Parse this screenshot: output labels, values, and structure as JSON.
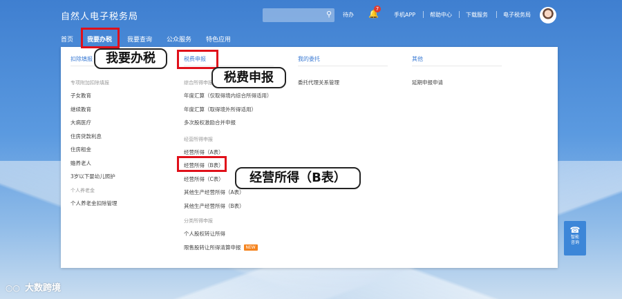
{
  "header": {
    "title": "自然人电子税务局",
    "search_placeholder": "",
    "todo_label": "待办",
    "notification_count": "7",
    "links": [
      "手机APP",
      "帮助中心",
      "下载服务",
      "电子税务局"
    ]
  },
  "nav": {
    "items": [
      "首页",
      "我要办税",
      "我要查询",
      "公众服务",
      "特色应用"
    ],
    "active_index": 1
  },
  "menu": {
    "col1": {
      "head": "扣除填报",
      "groups": [
        {
          "label": "专项附加扣除填报",
          "items": [
            "子女教育",
            "继续教育",
            "大病医疗",
            "住房贷款利息",
            "住房租金",
            "赡养老人",
            "3岁以下婴幼儿照护"
          ]
        },
        {
          "label": "个人养老金",
          "items": [
            "个人养老金扣除管理"
          ]
        }
      ]
    },
    "col2": {
      "head": "税费申报",
      "groups": [
        {
          "label": "综合所得申报",
          "items": [
            "年度汇算（仅取得境内综合所得适用）",
            "年度汇算（取得境外所得适用）",
            "多次股权激励合并申报"
          ]
        },
        {
          "label": "经营所得申报",
          "items": [
            "经营所得（A表）",
            "经营所得（B表）",
            "经营所得（C表）",
            "其他生产经营所得（A表）",
            "其他生产经营所得（B表）"
          ]
        },
        {
          "label": "分类所得申报",
          "items": [
            "个人股权转让所得",
            "限售股转让所得清算申报"
          ]
        }
      ],
      "new_badge": "NEW"
    },
    "col3": {
      "head": "我的委托",
      "items": [
        "委托代理关系管理"
      ]
    },
    "col4": {
      "head": "其他",
      "items": [
        "延期申报申请"
      ]
    }
  },
  "callouts": {
    "nav": "我要办税",
    "head": "税费申报",
    "item": "经营所得（B表）"
  },
  "side_widget": {
    "label_line1": "智能",
    "label_line2": "咨询"
  },
  "watermark": "大数跨境",
  "colors": {
    "accent": "#3b7bd4",
    "highlight": "#e0101a",
    "new_badge": "#f5841f"
  }
}
